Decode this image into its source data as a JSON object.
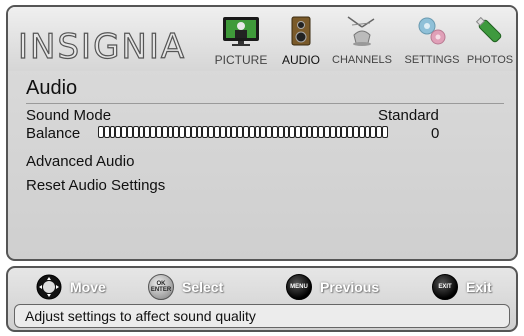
{
  "brand": "INSIGNIA",
  "tabs": [
    {
      "label": "PICTURE",
      "icon": "tv-icon"
    },
    {
      "label": "AUDIO",
      "icon": "speaker-icon"
    },
    {
      "label": "CHANNELS",
      "icon": "antenna-icon"
    },
    {
      "label": "SETTINGS",
      "icon": "gears-icon"
    },
    {
      "label": "PHOTOS",
      "icon": "usb-drive-icon"
    }
  ],
  "active_tab": "AUDIO",
  "section": {
    "title": "Audio",
    "items": [
      {
        "label": "Sound Mode",
        "value": "Standard"
      },
      {
        "label": "Balance",
        "value": "0"
      },
      {
        "label": "Advanced Audio"
      },
      {
        "label": "Reset Audio Settings"
      }
    ]
  },
  "balance_level": 0,
  "nav": {
    "move": {
      "label": "Move",
      "icon": "dpad-icon"
    },
    "select": {
      "label": "Select",
      "button_text": "OK ENTER"
    },
    "previous": {
      "label": "Previous",
      "button_text": "MENU"
    },
    "exit": {
      "label": "Exit",
      "button_text": "EXIT"
    }
  },
  "hint": "Adjust settings to affect sound quality",
  "colors": {
    "panel_border": "#555555",
    "button_dark": "#000000",
    "nav_label": "#ffffff"
  }
}
